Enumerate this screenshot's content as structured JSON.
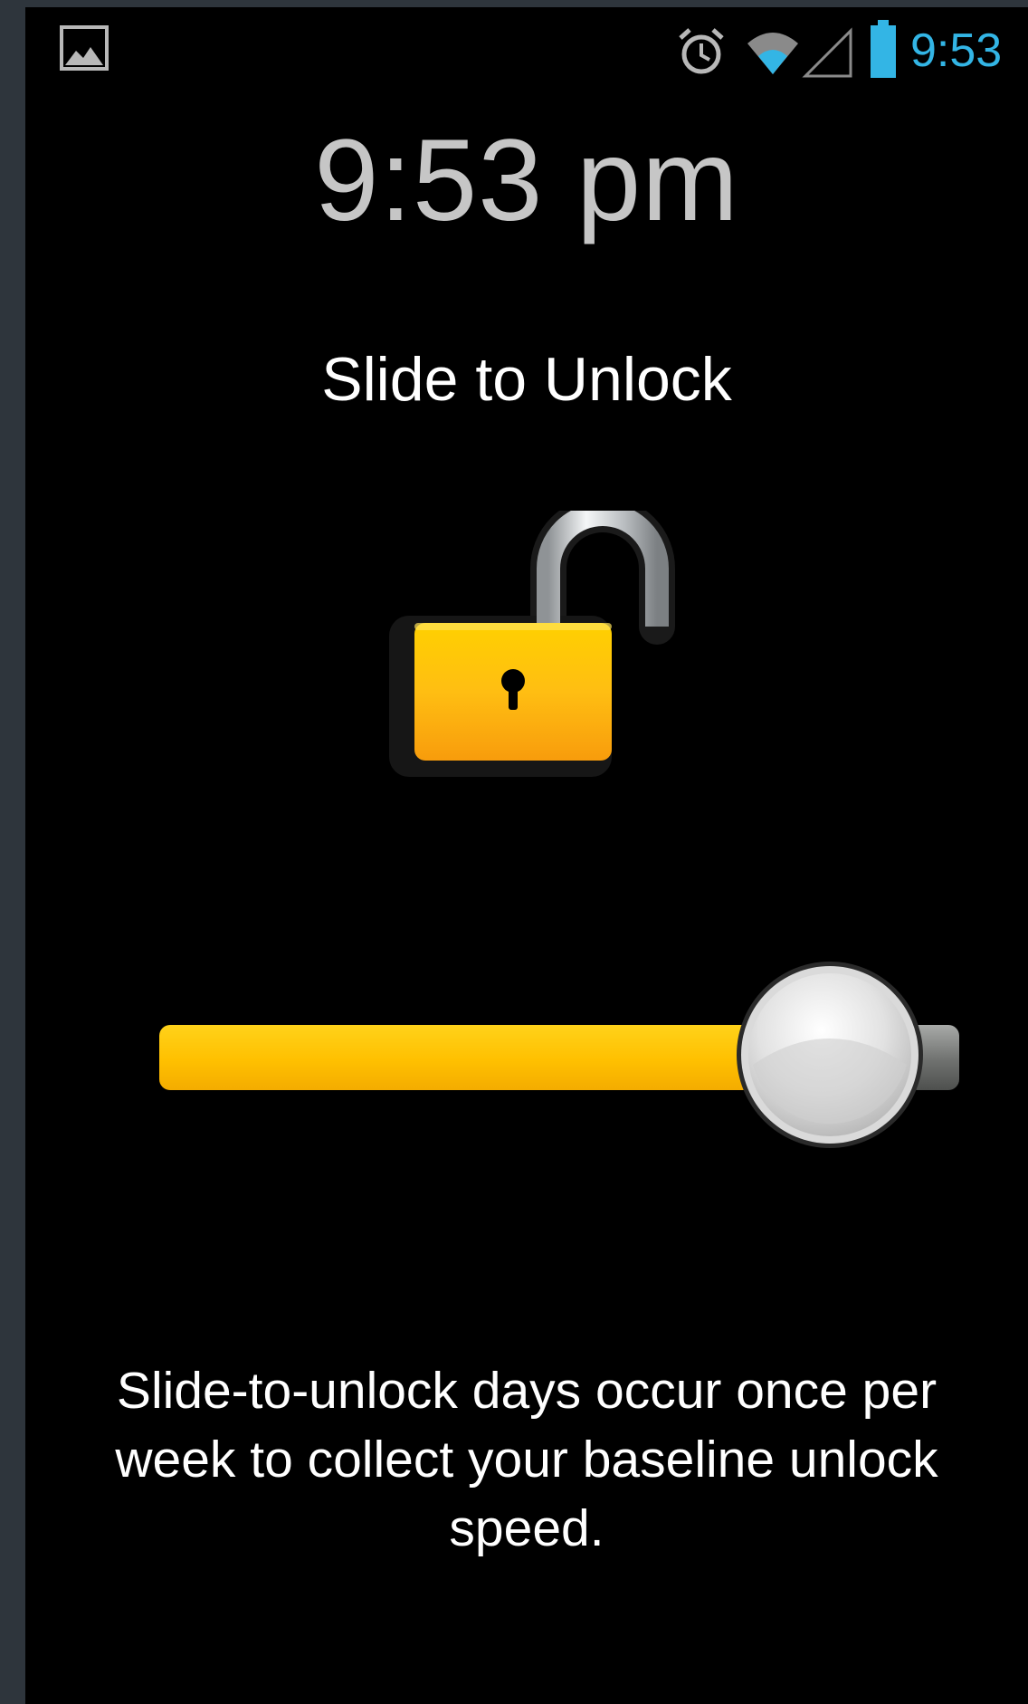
{
  "status_bar": {
    "time": "9:53",
    "icons": [
      "gallery-icon",
      "alarm-icon",
      "wifi-icon",
      "signal-icon",
      "battery-icon"
    ],
    "time_color": "#33b5e5"
  },
  "lock_screen": {
    "clock": "9:53 pm",
    "title": "Slide to Unlock",
    "lock_icon": "padlock-open-icon",
    "slider_progress_percent": 75,
    "description": "Slide-to-unlock days occur once per week to collect your baseline unlock speed."
  },
  "colors": {
    "background": "#000000",
    "accent_yellow": "#ffc000",
    "clock_text": "#c6c6c6",
    "frame": "#2e353c"
  }
}
